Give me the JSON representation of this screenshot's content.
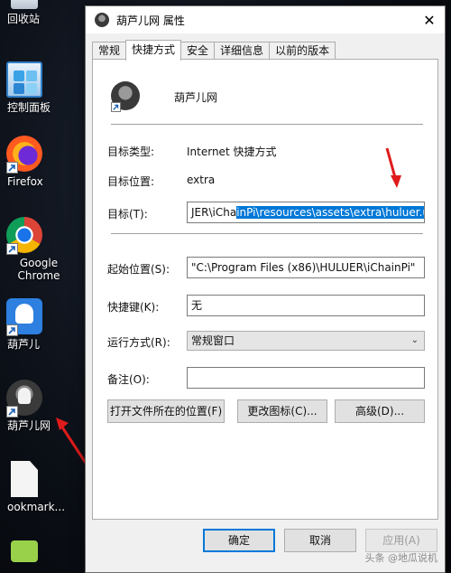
{
  "desktop": {
    "icons": [
      {
        "label": "回收站",
        "icon": "recycle-bin-icon"
      },
      {
        "label": "控制面板",
        "icon": "control-panel-icon"
      },
      {
        "label": "Firefox",
        "icon": "firefox-icon"
      },
      {
        "label": "Google Chrome",
        "icon": "chrome-icon"
      },
      {
        "label": "葫芦儿",
        "icon": "huluer-app-icon"
      },
      {
        "label": "葫芦儿网",
        "icon": "huluer-web-shortcut-icon"
      },
      {
        "label": "ookmark...",
        "icon": "document-icon"
      }
    ]
  },
  "dialog": {
    "title": "葫芦儿网 属性",
    "close_glyph": "✕",
    "tabs": [
      "常规",
      "快捷方式",
      "安全",
      "详细信息",
      "以前的版本"
    ],
    "active_tab": "快捷方式",
    "name": "葫芦儿网",
    "target_type_label": "目标类型:",
    "target_type_value": "Internet 快捷方式",
    "target_location_label": "目标位置:",
    "target_location_value": "extra",
    "target_label": "目标(T):",
    "target_value_prefix": "JER\\iCha",
    "target_value_selected": "inPi\\resources\\assets\\extra\\huluer.url\"",
    "start_in_label": "起始位置(S):",
    "start_in_value": "\"C:\\Program Files (x86)\\HULUER\\iChainPi\"",
    "hotkey_label": "快捷键(K):",
    "hotkey_value": "无",
    "run_label": "运行方式(R):",
    "run_value": "常规窗口",
    "comment_label": "备注(O):",
    "comment_value": "",
    "open_location_button": "打开文件所在的位置(F)",
    "change_icon_button": "更改图标(C)...",
    "advanced_button": "高级(D)...",
    "ok_button": "确定",
    "cancel_button": "取消",
    "apply_button": "应用(A)"
  },
  "watermark": "头条 @地瓜说机"
}
